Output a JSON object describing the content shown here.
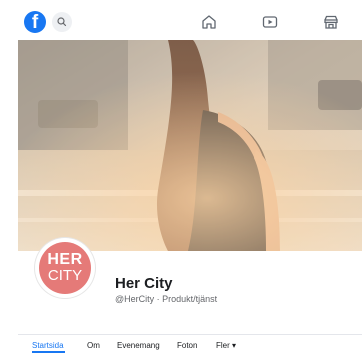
{
  "topbar": {
    "logo_letter": "f"
  },
  "page": {
    "name": "Her City",
    "handle_category": "@HerCity · Produkt/tjänst",
    "avatar_line1": "HER",
    "avatar_line2": "CITY",
    "avatar_color": "#e57a78"
  },
  "tabs": [
    {
      "label": "Startsida",
      "active": true
    },
    {
      "label": "Om",
      "active": false
    },
    {
      "label": "Evenemang",
      "active": false
    },
    {
      "label": "Foton",
      "active": false
    },
    {
      "label": "Fler ▾",
      "active": false
    }
  ],
  "colors": {
    "accent": "#1877f2"
  }
}
